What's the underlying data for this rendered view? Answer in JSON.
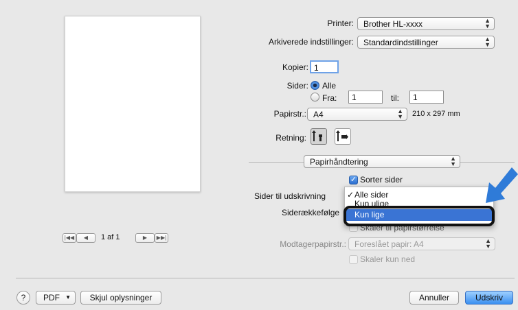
{
  "printer": {
    "label": "Printer:",
    "value": "Brother HL-xxxx"
  },
  "presets": {
    "label": "Arkiverede indstillinger:",
    "value": "Standardindstillinger"
  },
  "copies": {
    "label": "Kopier:",
    "value": "1"
  },
  "pages": {
    "label": "Sider:",
    "all": "Alle",
    "from_label": "Fra:",
    "from_value": "1",
    "to_label": "til:",
    "to_value": "1"
  },
  "paper_size": {
    "label": "Papirstr.:",
    "value": "A4",
    "dimensions": "210 x 297 mm"
  },
  "orientation": {
    "label": "Retning:"
  },
  "section": {
    "value": "Papirhåndtering"
  },
  "collate": {
    "label": "Sorter sider",
    "checked": true
  },
  "pages_to_print": {
    "label": "Sider til udskrivning"
  },
  "page_order": {
    "label": "Siderækkefølge"
  },
  "dropdown": {
    "items": [
      {
        "check": "✓",
        "label": "Alle sider"
      },
      {
        "check": "",
        "label": "Kun ulige"
      },
      {
        "check": "",
        "label": "Kun lige"
      }
    ],
    "selected_index": 2
  },
  "scale_to_fit": {
    "label": "Skaler til papirstørrelse"
  },
  "dest_paper": {
    "label": "Modtagerpapirstr.:",
    "value": "Foreslået papir: A4"
  },
  "scale_down": {
    "label": "Skaler kun ned"
  },
  "preview": {
    "page_indicator": "1 af 1"
  },
  "footer": {
    "help": "?",
    "pdf": "PDF",
    "hide_details": "Skjul oplysninger",
    "cancel": "Annuller",
    "print": "Udskriv"
  },
  "colors": {
    "highlight": "#3a74d4",
    "primary_button": "#3a8ff0",
    "callout_arrow": "#2f7bd8"
  }
}
